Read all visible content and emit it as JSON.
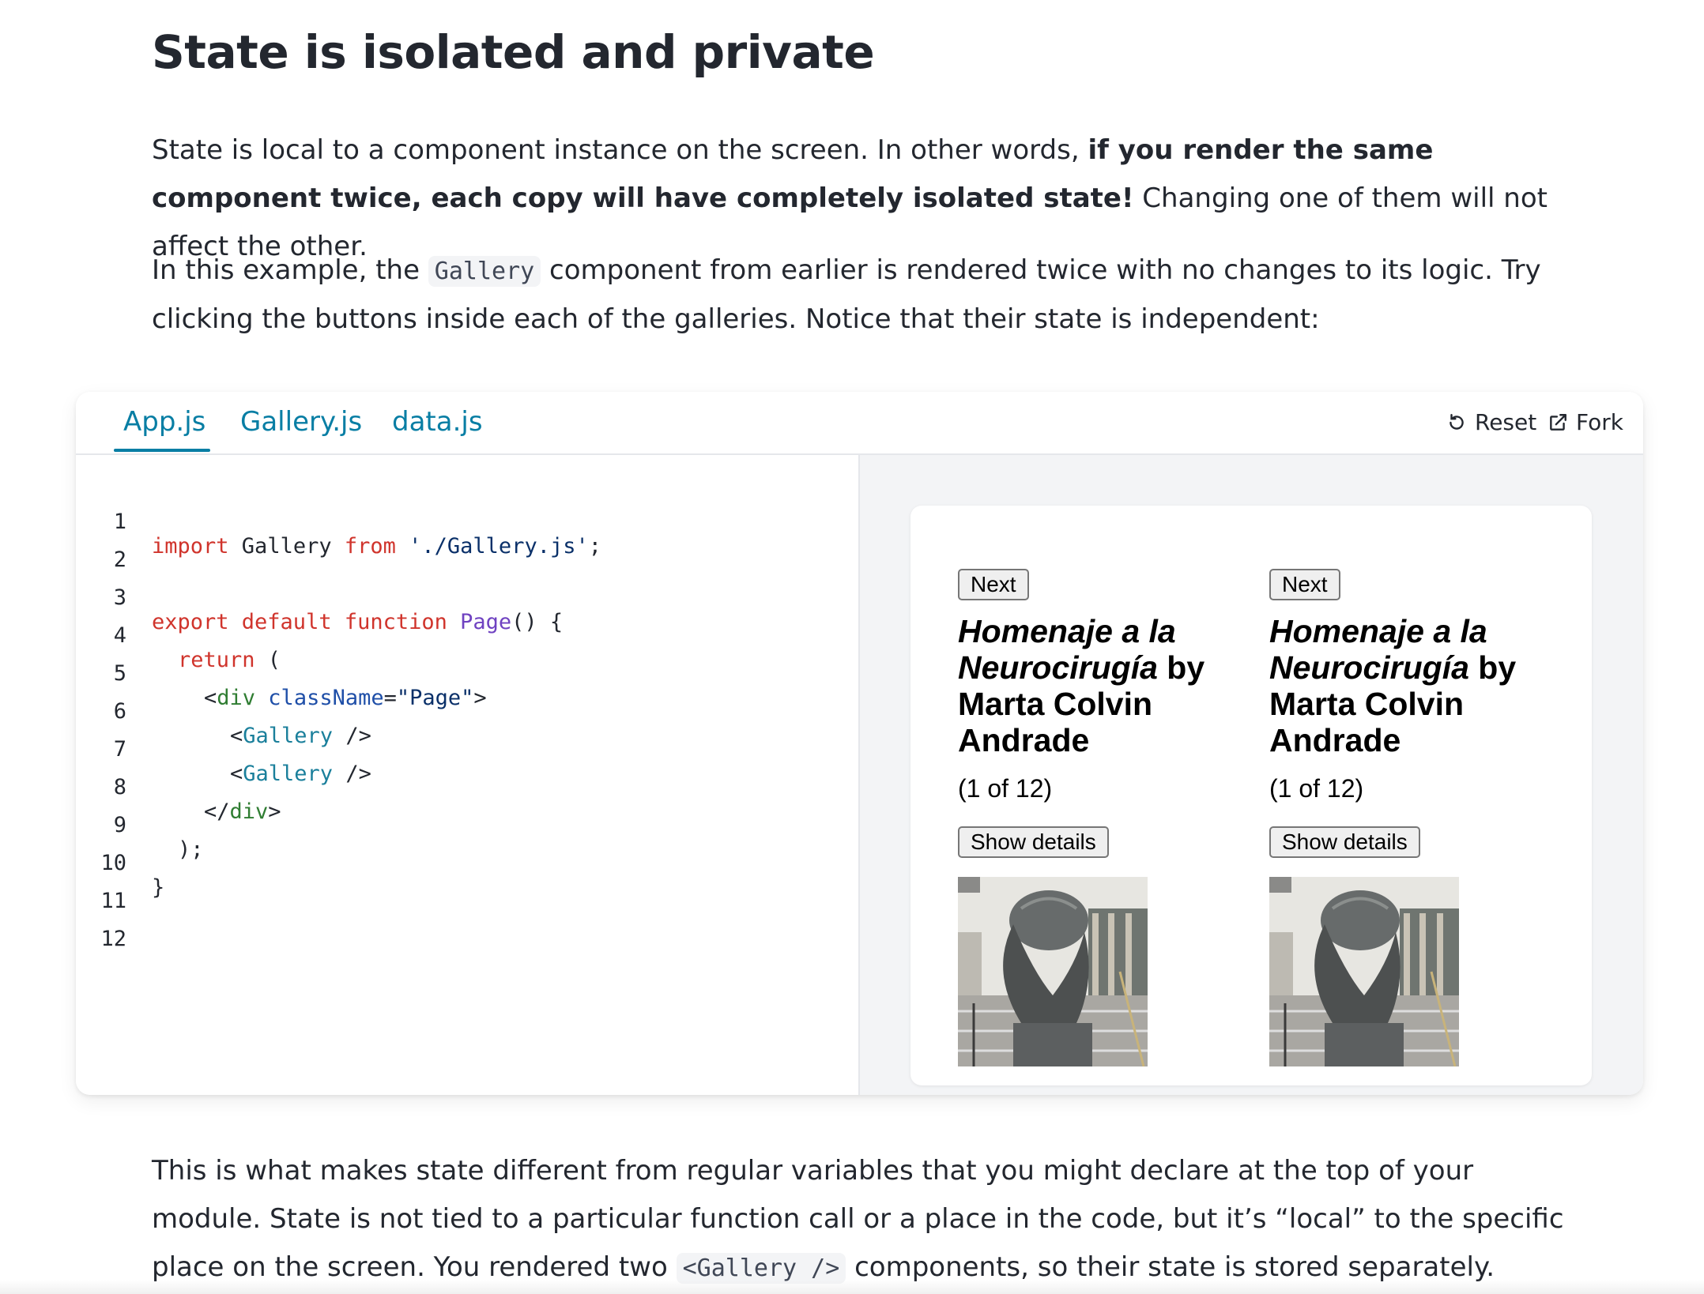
{
  "heading": "State is isolated and private",
  "para1": {
    "text1": "State is local to a component instance on the screen. In other words, ",
    "bold": "if you render the same component twice, each copy will have completely isolated state!",
    "text2": " Changing one of them will not affect the other."
  },
  "para2": {
    "text1": "In this example, the ",
    "code": "Gallery",
    "text2": " component from earlier is rendered twice with no changes to its logic. Try clicking the buttons inside each of the galleries. Notice that their state is independent:"
  },
  "sandbox": {
    "tabs": [
      "App.js",
      "Gallery.js",
      "data.js"
    ],
    "active_tab": "App.js",
    "reset_label": "Reset",
    "fork_label": "Fork",
    "code_lines": [
      {
        "n": "1"
      },
      {
        "n": "2"
      },
      {
        "n": "3"
      },
      {
        "n": "4"
      },
      {
        "n": "5"
      },
      {
        "n": "6"
      },
      {
        "n": "7"
      },
      {
        "n": "8"
      },
      {
        "n": "9"
      },
      {
        "n": "10"
      },
      {
        "n": "11"
      },
      {
        "n": "12"
      }
    ],
    "code_tokens": {
      "l1_import": "import",
      "l1_name": " Gallery ",
      "l1_from": "from",
      "l1_path": " './Gallery.js'",
      "l1_end": ";",
      "l3_export": "export default function",
      "l3_name": " Page",
      "l3_end": "() {",
      "l4_return": "return",
      "l4_end": " (",
      "l5_open": "<",
      "l5_tag": "div",
      "l5_attr": " className",
      "l5_eq": "=",
      "l5_val": "\"Page\"",
      "l5_close": ">",
      "l6_open": "<",
      "l6_comp": "Gallery",
      "l6_close": " />",
      "l7_open": "<",
      "l7_comp": "Gallery",
      "l7_close": " />",
      "l8_open": "</",
      "l8_tag": "div",
      "l8_close": ">",
      "l9": ");",
      "l10": "}"
    },
    "galleries": [
      {
        "next_label": "Next",
        "title_italic1": "Homenaje a la",
        "title_italic2": "Neurocirugía",
        "title_by": " by",
        "artist": "Marta Colvin Andrade",
        "count": "(1 of 12)",
        "details_label": "Show details"
      },
      {
        "next_label": "Next",
        "title_italic1": "Homenaje a la",
        "title_italic2": "Neurocirugía",
        "title_by": " by",
        "artist": "Marta Colvin Andrade",
        "count": "(1 of 12)",
        "details_label": "Show details"
      }
    ]
  },
  "para3": {
    "text1": "This is what makes state different from regular variables that you might declare at the top of your module. State is not tied to a particular function call or a place in the code, but it’s “local” to the specific place on the screen. You rendered two ",
    "code": "<Gallery />",
    "text2": " components, so their state is stored separately."
  }
}
